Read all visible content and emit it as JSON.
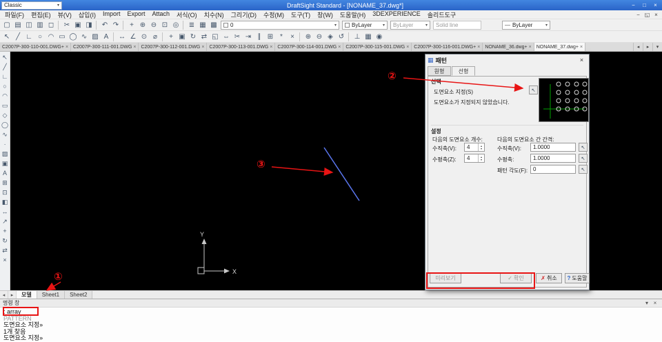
{
  "colors": {
    "titlebar": "#2a64c8",
    "accent_red": "#e81414",
    "line_blue": "#5a76ee",
    "ucs_gray": "#c8c8c8",
    "preview_green": "#00a000"
  },
  "titlebar": {
    "workspace": "Classic",
    "workspace_caret": "▾",
    "title": "DraftSight Standard - [NONAME_37.dwg*]",
    "controls": {
      "minimize": "−",
      "maximize": "□",
      "close": "×"
    }
  },
  "menubar": {
    "items": [
      {
        "label": "파일(F)"
      },
      {
        "label": "편집(E)"
      },
      {
        "label": "뷰(V)"
      },
      {
        "label": "삽입(I)"
      },
      {
        "label": "Import"
      },
      {
        "label": "Export"
      },
      {
        "label": "Attach"
      },
      {
        "label": "서식(O)"
      },
      {
        "label": "치수(N)"
      },
      {
        "label": "그리기(D)"
      },
      {
        "label": "수정(M)"
      },
      {
        "label": "도구(T)"
      },
      {
        "label": "창(W)"
      },
      {
        "label": "도움말(H)"
      },
      {
        "label": "3DEXPERIENCE"
      },
      {
        "label": "솔리드도구"
      }
    ],
    "doc_controls": {
      "minimize": "−",
      "restore": "◱",
      "close": "×"
    }
  },
  "toolbar1": {
    "icons": [
      {
        "name": "new-icon",
        "glyph": "▢"
      },
      {
        "name": "open-icon",
        "glyph": "▤"
      },
      {
        "name": "save-icon",
        "glyph": "◫"
      },
      {
        "name": "print-icon",
        "glyph": "▥"
      },
      {
        "name": "print-preview-icon",
        "glyph": "◻"
      },
      {
        "name": "toolbar-separator",
        "sep": true
      },
      {
        "name": "cut-icon",
        "glyph": "✂"
      },
      {
        "name": "copy-icon",
        "glyph": "▣"
      },
      {
        "name": "paste-icon",
        "glyph": "◨"
      },
      {
        "name": "toolbar-separator",
        "sep": true
      },
      {
        "name": "undo-icon",
        "glyph": "↶"
      },
      {
        "name": "redo-icon",
        "glyph": "↷"
      },
      {
        "name": "toolbar-separator",
        "sep": true
      },
      {
        "name": "pan-icon",
        "glyph": "+"
      },
      {
        "name": "zoom-in-icon",
        "glyph": "⊕"
      },
      {
        "name": "zoom-out-icon",
        "glyph": "⊖"
      },
      {
        "name": "zoom-window-icon",
        "glyph": "⊡"
      },
      {
        "name": "zoom-fit-icon",
        "glyph": "◎"
      },
      {
        "name": "toolbar-separator",
        "sep": true
      },
      {
        "name": "properties-icon",
        "glyph": "≣"
      },
      {
        "name": "layer-manager-icon",
        "glyph": "▦"
      },
      {
        "name": "color-manager-icon",
        "glyph": "▩"
      }
    ],
    "layer_combo": "0",
    "color_combo": "ByLayer",
    "linestyle_combo": "ByLayer",
    "linestyle_name": "Solid line",
    "lineweight_glyph": "—",
    "lineweight_combo": "ByLayer",
    "caret": "▾"
  },
  "toolbar2": {
    "icons": [
      {
        "name": "select-icon",
        "glyph": "↖"
      },
      {
        "name": "line-icon",
        "glyph": "╱"
      },
      {
        "name": "polyline-icon",
        "glyph": "∟"
      },
      {
        "name": "circle-icon",
        "glyph": "○"
      },
      {
        "name": "arc-icon",
        "glyph": "◠"
      },
      {
        "name": "rectangle-icon",
        "glyph": "▭"
      },
      {
        "name": "ellipse-icon",
        "glyph": "◯"
      },
      {
        "name": "spline-icon",
        "glyph": "∿"
      },
      {
        "name": "hatch-icon",
        "glyph": "▨"
      },
      {
        "name": "text-icon",
        "glyph": "A"
      },
      {
        "name": "toolbar-separator",
        "sep": true
      },
      {
        "name": "dim-linear-icon",
        "glyph": "↔"
      },
      {
        "name": "dim-angular-icon",
        "glyph": "∠"
      },
      {
        "name": "dim-radius-icon",
        "glyph": "⊙"
      },
      {
        "name": "dim-diameter-icon",
        "glyph": "⌀"
      },
      {
        "name": "toolbar-separator",
        "sep": true
      },
      {
        "name": "move-icon",
        "glyph": "+"
      },
      {
        "name": "copy-entities-icon",
        "glyph": "▣"
      },
      {
        "name": "rotate-icon",
        "glyph": "↻"
      },
      {
        "name": "mirror-icon",
        "glyph": "⇄"
      },
      {
        "name": "scale-icon",
        "glyph": "◱"
      },
      {
        "name": "stretch-icon",
        "glyph": "⇔"
      },
      {
        "name": "trim-icon",
        "glyph": "✂"
      },
      {
        "name": "extend-icon",
        "glyph": "⇥"
      },
      {
        "name": "offset-icon",
        "glyph": "∥"
      },
      {
        "name": "pattern-icon",
        "glyph": "⊞"
      },
      {
        "name": "explode-icon",
        "glyph": "*"
      },
      {
        "name": "erase-icon",
        "glyph": "×"
      },
      {
        "name": "toolbar-separator",
        "sep": true
      },
      {
        "name": "zoom-in-icon",
        "glyph": "⊕"
      },
      {
        "name": "zoom-out-icon",
        "glyph": "⊖"
      },
      {
        "name": "pan-icon",
        "glyph": "◈"
      },
      {
        "name": "rebuild-icon",
        "glyph": "↺"
      },
      {
        "name": "toolbar-separator",
        "sep": true
      },
      {
        "name": "ortho-icon",
        "glyph": "⊥"
      },
      {
        "name": "grid-icon",
        "glyph": "▦"
      },
      {
        "name": "snap-icon",
        "glyph": "◉"
      }
    ]
  },
  "doc_tabs": {
    "tabs": [
      {
        "label": "C2007P-300-110-001.DWG+",
        "close": "×"
      },
      {
        "label": "C2007P-300-111-001.DWG",
        "close": "×"
      },
      {
        "label": "C2007P-300-112-001.DWG",
        "close": "×"
      },
      {
        "label": "C2007P-300-113-001.DWG",
        "close": "×"
      },
      {
        "label": "C2007P-300-114-001.DWG",
        "close": "×"
      },
      {
        "label": "C2007P-300-115-001.DWG",
        "close": "×"
      },
      {
        "label": "C2007P-300-116-001.DWG+",
        "close": "×"
      },
      {
        "label": "NONAME_36.dwg+",
        "close": "×"
      },
      {
        "label": "NONAME_37.dwg+",
        "close": "×",
        "active": true
      }
    ],
    "nav": {
      "left": "◂",
      "right": "▸",
      "menu": "▾"
    }
  },
  "palette": {
    "icons": [
      {
        "name": "select-tool-icon",
        "glyph": "↖"
      },
      {
        "name": "line-tool-icon",
        "glyph": "╱"
      },
      {
        "name": "polyline-tool-icon",
        "glyph": "∟"
      },
      {
        "name": "circle-tool-icon",
        "glyph": "○"
      },
      {
        "name": "arc-tool-icon",
        "glyph": "◠"
      },
      {
        "name": "rectangle-tool-icon",
        "glyph": "▭"
      },
      {
        "name": "polygon-tool-icon",
        "glyph": "◇"
      },
      {
        "name": "ellipse-tool-icon",
        "glyph": "◯"
      },
      {
        "name": "spline-tool-icon",
        "glyph": "∿"
      },
      {
        "name": "point-tool-icon",
        "glyph": "∙"
      },
      {
        "name": "hatch-tool-icon",
        "glyph": "▨"
      },
      {
        "name": "region-tool-icon",
        "glyph": "▣"
      },
      {
        "name": "text-tool-icon",
        "glyph": "A"
      },
      {
        "name": "table-tool-icon",
        "glyph": "⊞"
      },
      {
        "name": "insert-block-tool-icon",
        "glyph": "⊡"
      },
      {
        "name": "make-block-tool-icon",
        "glyph": "◧"
      },
      {
        "name": "dimension-tool-icon",
        "glyph": "↔"
      },
      {
        "name": "leader-tool-icon",
        "glyph": "↗"
      },
      {
        "name": "move-tool-icon",
        "glyph": "+"
      },
      {
        "name": "rotate-tool-icon",
        "glyph": "↻"
      },
      {
        "name": "mirror-tool-icon",
        "glyph": "⇄"
      },
      {
        "name": "erase-tool-icon",
        "glyph": "×"
      }
    ]
  },
  "canvas": {
    "ucs": {
      "x_label": "X",
      "y_label": "Y"
    }
  },
  "annotations": {
    "n1": "①",
    "n2": "②",
    "n3": "③"
  },
  "dialog": {
    "title": "패턴",
    "icon": "▦",
    "close": "×",
    "tabs": [
      {
        "label": "원형"
      },
      {
        "label": "선형",
        "active": true
      }
    ],
    "pick_glyph": "↖",
    "spin_up": "▴",
    "spin_down": "▾",
    "selection": {
      "heading": "선택",
      "specify_label": "도면요소 지정(S)",
      "status": "도면요소가 지정되지 않았습니다."
    },
    "settings": {
      "heading": "설정",
      "count_header": "다음의 도면요소 개수:",
      "spacing_header": "다음의 도면요소 간 간격:",
      "rows": [
        {
          "count_label": "수직축(V):",
          "count_value": "4",
          "spacing_label": "수직축(V):",
          "spacing_value": "1.0000"
        },
        {
          "count_label": "수평축(Z):",
          "count_value": "4",
          "spacing_label": "수평축:",
          "spacing_value": "1.0000"
        }
      ],
      "angle_label": "패턴 각도(F):",
      "angle_value": "0"
    },
    "buttons": {
      "preview": "미리보기",
      "ok": "확인",
      "ok_icon": "✓",
      "cancel": "취소",
      "cancel_icon": "✗",
      "help": "도움말",
      "help_icon": "?"
    }
  },
  "sheetbar": {
    "nav_left": "◂",
    "nav_right": "▸",
    "tabs": [
      {
        "label": "모델",
        "active": true
      },
      {
        "label": "Sheet1"
      },
      {
        "label": "Sheet2"
      }
    ]
  },
  "command": {
    "header": "명령 창",
    "float_icon": "▾",
    "close_icon": "×",
    "lines": [
      {
        "text": ": array"
      },
      {
        "text": "PATTERN",
        "dim": true
      },
      {
        "text": "도면요소 지정»"
      },
      {
        "text": "1개 찾음"
      },
      {
        "text": "도면요소 지정»"
      }
    ]
  }
}
